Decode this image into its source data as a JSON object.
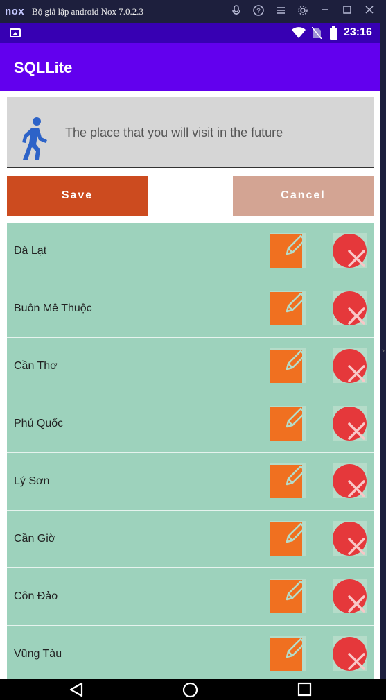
{
  "emulator": {
    "logo": "nox",
    "title": "Bộ giả lập android Nox 7.0.2.3",
    "controls": [
      "mic-icon",
      "help-icon",
      "menu-icon",
      "settings-icon",
      "minimize-icon",
      "maximize-icon",
      "close-icon"
    ]
  },
  "status_bar": {
    "time": "23:16",
    "icons": [
      "image-icon",
      "wifi-icon",
      "no-sim-icon",
      "battery-icon"
    ],
    "bg_color": "#3700b3"
  },
  "app_bar": {
    "title": "SQLLite",
    "bg_color": "#6200ee"
  },
  "input": {
    "icon": "walking-person-icon",
    "placeholder": "The place that you will visit in the future"
  },
  "buttons": {
    "save_label": "Save",
    "cancel_label": "Cancel",
    "save_color": "#cc4b1f",
    "cancel_color": "#d3a493"
  },
  "places": [
    {
      "name": "Đà Lạt"
    },
    {
      "name": "Buôn Mê Thuộc"
    },
    {
      "name": "Cần Thơ"
    },
    {
      "name": "Phú Quốc"
    },
    {
      "name": "Lý Sơn"
    },
    {
      "name": "Cần Giờ"
    },
    {
      "name": "Côn Đảo"
    },
    {
      "name": "Vũng Tàu"
    }
  ],
  "row_actions": {
    "edit_icon": "edit-icon",
    "delete_icon": "delete-icon",
    "row_color": "#9dd2bc",
    "edit_color": "#f07020",
    "delete_color": "#e5383b"
  },
  "nav_bar": {
    "items": [
      "back-icon",
      "home-icon",
      "recents-icon"
    ]
  }
}
